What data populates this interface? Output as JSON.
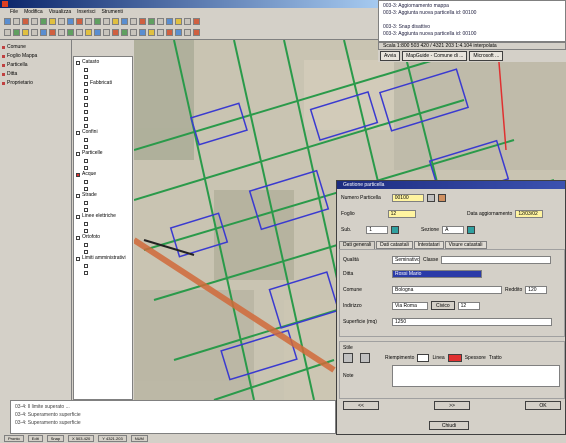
{
  "window": {
    "title": ""
  },
  "menu": [
    "File",
    "Modifica",
    "Visualizza",
    "Inserisci",
    "Strumenti"
  ],
  "left_panel": [
    "Comune",
    "Foglio Mappa",
    "Particella",
    "Ditta",
    "Proprietario"
  ],
  "layers": [
    {
      "label": "Catasto",
      "on": false,
      "indent": false
    },
    {
      "label": "Fabbricati",
      "on": false,
      "indent": true
    },
    {
      "label": "Confini",
      "on": false,
      "indent": false
    },
    {
      "label": "Particelle",
      "on": false,
      "indent": false
    },
    {
      "label": "Acque",
      "on": true,
      "indent": false
    },
    {
      "label": "Strade",
      "on": false,
      "indent": false
    },
    {
      "label": "Linee elettriche",
      "on": false,
      "indent": false
    },
    {
      "label": "Ortofoto",
      "on": false,
      "indent": false
    },
    {
      "label": "Limiti amministrativi",
      "on": false,
      "indent": false
    }
  ],
  "info_log": [
    "003-3: Aggiornamento mappa",
    "003-3: Aggiunta nuova particella id: 00100",
    "",
    "003-3: Snap disattivo",
    "003-3: Aggiunta nuova particella id: 00100"
  ],
  "scale_text": "Scala 1:800   503 420 / 4321 203  1:4.104 interpolata",
  "top_tabs": [
    "Avvia",
    "MapGuide - Comune di ...",
    "Microsoft ..."
  ],
  "status_log": [
    "03-4: Il limite superato ...",
    "03-4: Superamento superficie",
    "03-4: Superamento superficie"
  ],
  "bottom_bar": [
    "Pronto",
    "Edit",
    "Snap",
    "X 503.420",
    "Y 4321.203",
    "NUM"
  ],
  "dialog": {
    "title": "Gestione particella",
    "fields": {
      "numero_label": "Numero Particella",
      "numero": "00100",
      "foglio_label": "Foglio",
      "foglio": "12",
      "sub_label": "Sub.",
      "sub": "1",
      "sezione_label": "Sezione",
      "sezione": "A",
      "data_label": "Data aggiornamento",
      "data": "12/03/02"
    },
    "tabs": [
      "Dati generali",
      "Dati catastali",
      "Intestatari",
      "Visure catastali"
    ],
    "form": {
      "qualita_label": "Qualità",
      "qualita": "Seminativo",
      "classe_label": "Classe",
      "classe": "",
      "ditta_label": "Ditta",
      "ditta": "Rossi Mario",
      "comune_label": "Comune",
      "comune": "Bologna",
      "reddito_label": "Reddito",
      "reddito": "120",
      "indirizzo_label": "Indirizzo",
      "indirizzo": "Via Roma",
      "civico_label": "Civico",
      "civico": "12",
      "superficie_label": "Superficie (mq)",
      "superficie": "1250"
    },
    "style": {
      "group_label": "Stile",
      "riempimento_label": "Riempimento",
      "linea_label": "Linea",
      "spessore_label": "Spessore",
      "tratto_label": "Tratto",
      "note_label": "Note",
      "fill_color": "#ffffff",
      "line_color": "#e03030"
    },
    "buttons": {
      "prev": "<<",
      "next": ">>",
      "close": "Chiudi",
      "ok": "OK"
    }
  },
  "colors": {
    "accent": "#0a246a",
    "parcel_line": "#2a9a4a",
    "building": "#3a3ad0",
    "road": "#d06a3a"
  }
}
